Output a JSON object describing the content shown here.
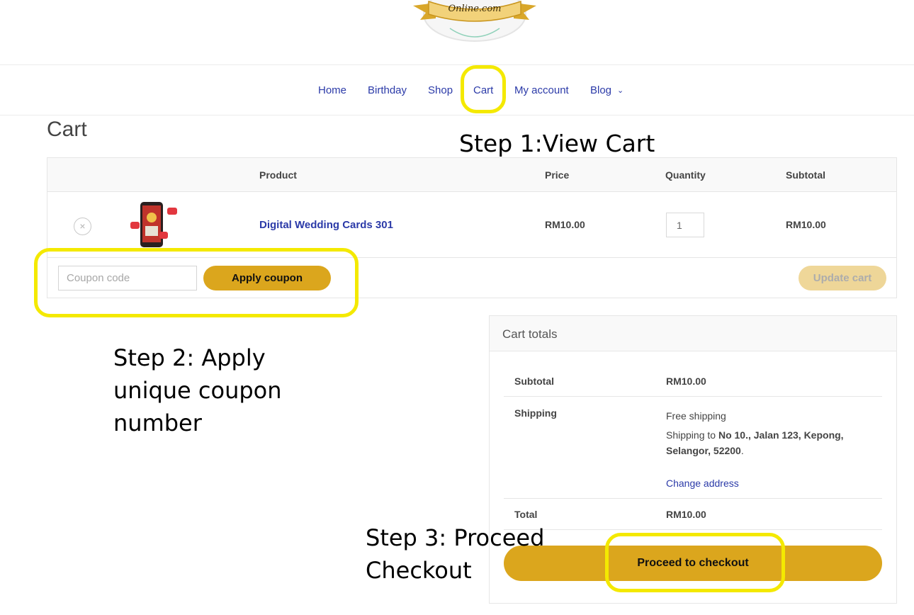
{
  "logo": {
    "text": "Online.com"
  },
  "nav": {
    "items": [
      {
        "label": "Home"
      },
      {
        "label": "Birthday"
      },
      {
        "label": "Shop"
      },
      {
        "label": "Cart"
      },
      {
        "label": "My account"
      },
      {
        "label": "Blog"
      }
    ]
  },
  "page": {
    "title": "Cart"
  },
  "cart": {
    "headers": {
      "product": "Product",
      "price": "Price",
      "quantity": "Quantity",
      "subtotal": "Subtotal"
    },
    "item": {
      "remove": "×",
      "name": "Digital Wedding Cards 301",
      "price": "RM10.00",
      "quantity": "1",
      "subtotal": "RM10.00"
    },
    "coupon_placeholder": "Coupon code",
    "apply_label": "Apply coupon",
    "update_label": "Update cart"
  },
  "totals": {
    "title": "Cart totals",
    "subtotal_label": "Subtotal",
    "subtotal_value": "RM10.00",
    "shipping_label": "Shipping",
    "shipping_method": "Free shipping",
    "shipping_to_prefix": "Shipping to ",
    "shipping_address": "No 10., Jalan 123, Kepong, Selangor, 52200",
    "shipping_suffix": ".",
    "change_address": "Change address",
    "total_label": "Total",
    "total_value": "RM10.00",
    "checkout_label": "Proceed to checkout"
  },
  "annotations": {
    "step1": "Step 1:View Cart",
    "step2": "Step 2: Apply unique coupon number",
    "step3": "Step 3: Proceed Checkout"
  },
  "colors": {
    "accent": "#dba61d",
    "link": "#2b3aa8",
    "highlight": "#f4e900"
  }
}
